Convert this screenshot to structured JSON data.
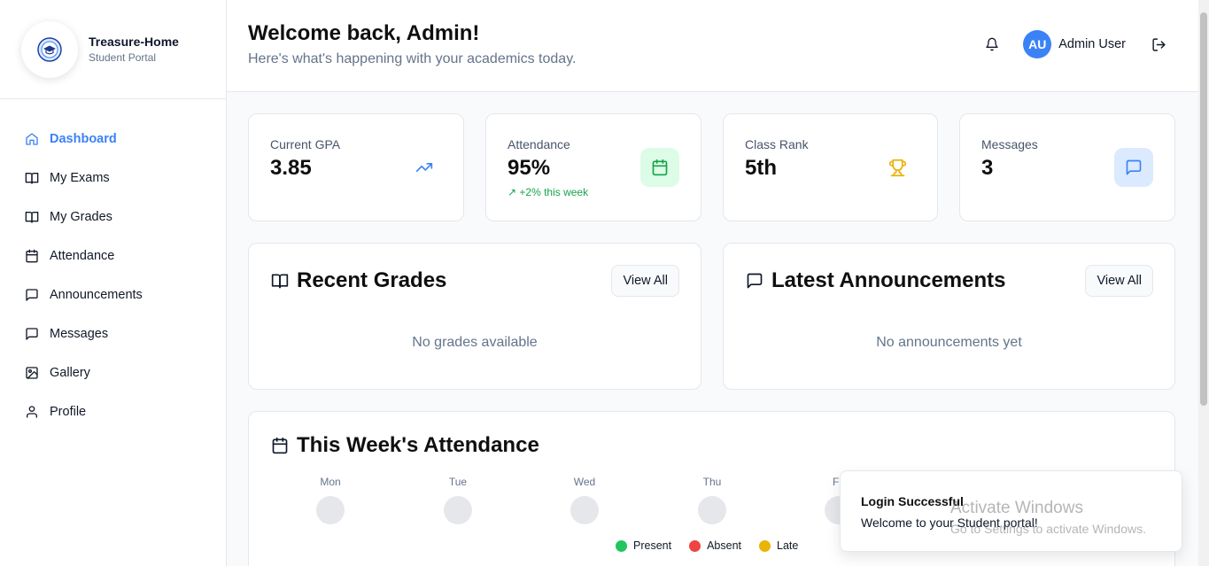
{
  "brand": {
    "name": "Treasure-Home",
    "subtitle": "Student Portal"
  },
  "sidebar": {
    "items": [
      {
        "label": "Dashboard",
        "icon": "home-icon",
        "active": true
      },
      {
        "label": "My Exams",
        "icon": "book-open-icon"
      },
      {
        "label": "My Grades",
        "icon": "book-open-icon"
      },
      {
        "label": "Attendance",
        "icon": "calendar-icon"
      },
      {
        "label": "Announcements",
        "icon": "message-square-icon"
      },
      {
        "label": "Messages",
        "icon": "message-square-icon"
      },
      {
        "label": "Gallery",
        "icon": "image-icon"
      },
      {
        "label": "Profile",
        "icon": "user-icon"
      }
    ]
  },
  "header": {
    "title": "Welcome back, Admin!",
    "subtitle": "Here's what's happening with your academics today.",
    "user_initials": "AU",
    "user_name": "Admin User"
  },
  "stats": [
    {
      "label": "Current GPA",
      "value": "3.85",
      "icon": "trending-up-icon"
    },
    {
      "label": "Attendance",
      "value": "95%",
      "sub": "↗ +2% this week",
      "icon": "calendar-icon"
    },
    {
      "label": "Class Rank",
      "value": "5th",
      "icon": "trophy-icon"
    },
    {
      "label": "Messages",
      "value": "3",
      "icon": "message-square-icon"
    }
  ],
  "grades": {
    "title": "Recent Grades",
    "button": "View All",
    "empty": "No grades available"
  },
  "announcements": {
    "title": "Latest Announcements",
    "button": "View All",
    "empty": "No announcements yet"
  },
  "attendance": {
    "title": "This Week's Attendance",
    "days": [
      "Mon",
      "Tue",
      "Wed",
      "Thu",
      "Fri"
    ],
    "legend": [
      {
        "label": "Present",
        "color": "#22c55e"
      },
      {
        "label": "Absent",
        "color": "#ef4444"
      },
      {
        "label": "Late",
        "color": "#eab308"
      }
    ]
  },
  "toast": {
    "title": "Login Successful",
    "description": "Welcome to your Student portal!"
  },
  "watermark": {
    "title": "Activate Windows",
    "subtitle": "Go to Settings to activate Windows."
  },
  "colors": {
    "accent": "#3b82f6",
    "present": "#22c55e",
    "absent": "#ef4444",
    "late": "#eab308"
  }
}
